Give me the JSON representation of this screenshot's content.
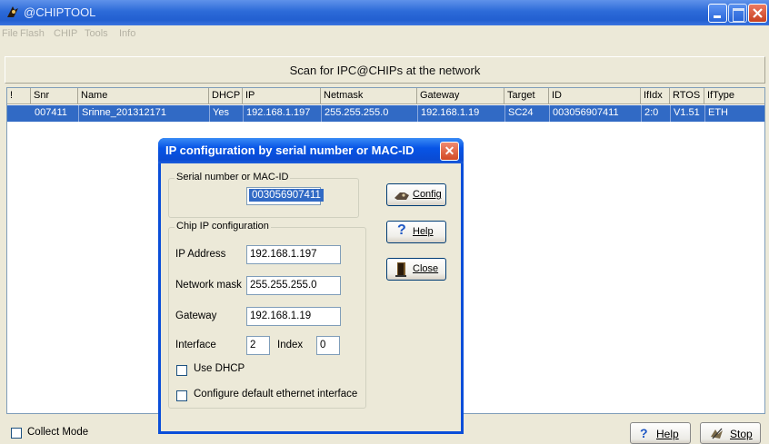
{
  "app": {
    "title": "@CHIPTOOL"
  },
  "menu": [
    "File",
    "Flash",
    "CHIP",
    "Tools",
    "Info"
  ],
  "scan": {
    "label": "Scan for IPC@CHIPs at the network"
  },
  "table": {
    "headers": [
      "!",
      "Snr",
      "Name",
      "DHCP",
      "IP",
      "Netmask",
      "Gateway",
      "Target",
      "ID",
      "IfIdx",
      "RTOS",
      "IfType"
    ],
    "rows": [
      [
        "",
        "007411",
        "Srinne_201312171",
        "Yes",
        "192.168.1.197",
        "255.255.255.0",
        "192.168.1.19",
        "SC24",
        "003056907411",
        "2:0",
        "V1.51",
        "ETH"
      ]
    ]
  },
  "footer": {
    "collect_mode": "Collect Mode",
    "help": "Help",
    "stop": "Stop"
  },
  "dialog": {
    "title": "IP configuration by serial number or MAC-ID",
    "close": "✕",
    "serial_group": "Serial number or MAC-ID",
    "serial_value": "003056907411",
    "chip_group": "Chip IP configuration",
    "ip_label": "IP Address",
    "ip_value": "192.168.1.197",
    "mask_label": "Network mask",
    "mask_value": "255.255.255.0",
    "gateway_label": "Gateway",
    "gateway_value": "192.168.1.19",
    "interface_label": "Interface",
    "interface_value": "2",
    "index_label": "Index",
    "index_value": "0",
    "use_dhcp": "Use DHCP",
    "default_iface": "Configure default ethernet interface",
    "buttons": {
      "config": "Config",
      "help": "Help",
      "close": "Close"
    }
  },
  "colors": {
    "titlebar": "#2c6ad8",
    "selection": "#316ac5",
    "window_bg": "#ece9d8"
  }
}
